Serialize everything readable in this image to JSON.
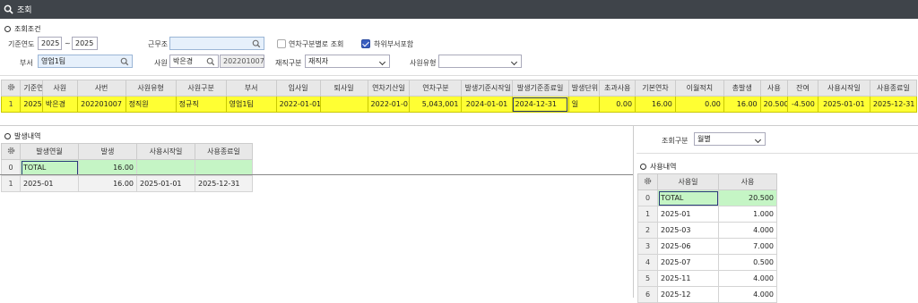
{
  "window": {
    "title": "조회"
  },
  "criteria": {
    "section_title": "조회조건",
    "year_label": "기준연도",
    "year_from": "2025",
    "year_sep": "~",
    "year_to": "2025",
    "work_group_label": "근무조",
    "work_group_value": "",
    "leave_by_type_label": "연차구분별로 조회",
    "include_sub_label": "하위부서포함",
    "dept_label": "부서",
    "dept_value": "영업1팀",
    "employee_label": "사원",
    "employee_name": "박은경",
    "employee_id": "202201007",
    "status_label": "재직구분",
    "status_value": "재직자",
    "emp_type_label": "사원유형",
    "emp_type_value": ""
  },
  "main_grid": {
    "headers": [
      "기준연도",
      "사원",
      "사번",
      "사원유형",
      "사원구분",
      "부서",
      "입사일",
      "퇴사일",
      "연차기산일",
      "연차구분",
      "발생기준시작일",
      "발생기준종료일",
      "발생단위",
      "초과사용",
      "기본연차",
      "이월적치",
      "총발생",
      "사용",
      "잔여",
      "사용시작일",
      "사용종료일"
    ],
    "rows": [
      {
        "no": "1",
        "cells": [
          "2025",
          "박은경",
          "202201007",
          "정직원",
          "정규직",
          "영업1팀",
          "2022-01-01",
          "",
          "2022-01-01",
          "5,043,001",
          "2024-01-01",
          "2024-12-31",
          "일",
          "0.00",
          "16.00",
          "0.00",
          "16.00",
          "20.500",
          "-4.500",
          "2025-01-01",
          "2025-12-31"
        ]
      }
    ]
  },
  "occurrence": {
    "section_title": "발생내역",
    "headers": [
      "발생연월",
      "발생",
      "사용시작일",
      "사용종료일"
    ],
    "rows": [
      {
        "no": "0",
        "cells": [
          "TOTAL",
          "16.00",
          "",
          ""
        ]
      },
      {
        "no": "1",
        "cells": [
          "2025-01",
          "16.00",
          "2025-01-01",
          "2025-12-31"
        ]
      }
    ]
  },
  "view_type": {
    "label": "조회구분",
    "value": "월별"
  },
  "usage": {
    "section_title": "사용내역",
    "headers": [
      "사용일",
      "사용"
    ],
    "rows": [
      {
        "no": "0",
        "cells": [
          "TOTAL",
          "20.500"
        ]
      },
      {
        "no": "1",
        "cells": [
          "2025-01",
          "1.000"
        ]
      },
      {
        "no": "2",
        "cells": [
          "2025-03",
          "4.000"
        ]
      },
      {
        "no": "3",
        "cells": [
          "2025-06",
          "7.000"
        ]
      },
      {
        "no": "4",
        "cells": [
          "2025-07",
          "0.500"
        ]
      },
      {
        "no": "5",
        "cells": [
          "2025-11",
          "4.000"
        ]
      },
      {
        "no": "6",
        "cells": [
          "2025-12",
          "4.000"
        ]
      }
    ]
  },
  "icons": {
    "search": "search-icon",
    "magnifier": "magnifier-icon",
    "gear": "gear-icon",
    "dropdown": "chevron-down-icon"
  },
  "colors": {
    "titlebar": "#3f444a",
    "selected_row": "#ffff33",
    "total_row": "#c5f5c5",
    "header_highlight": "#c8d4ec",
    "checkbox_on": "#3b5fc0"
  }
}
